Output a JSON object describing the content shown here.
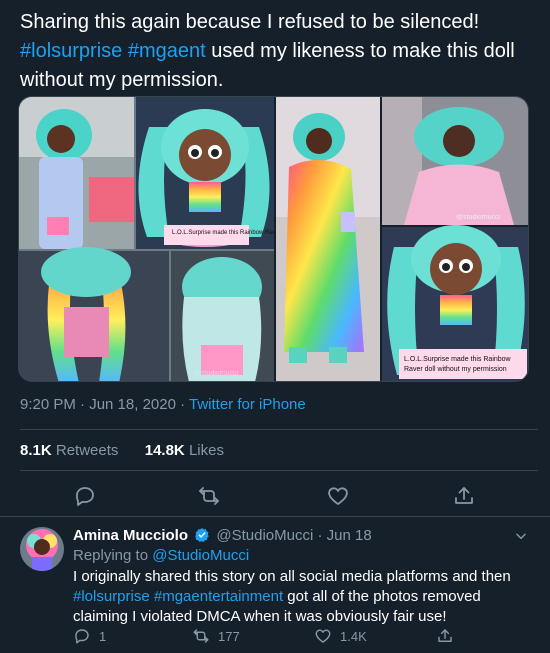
{
  "tweet": {
    "text_line1": "Sharing this again because I refused to be silenced!",
    "hashtag1": "#lolsurprise",
    "hashtag2": "#mgaent",
    "text_rest": "used my likeness to make this doll without my permission.",
    "time": "9:20 PM · Jun 18, 2020",
    "separator": " · ",
    "source": "Twitter for iPhone",
    "retweets_count": "8.1K",
    "retweets_label": "Retweets",
    "likes_count": "14.8K",
    "likes_label": "Likes",
    "media": {
      "caption_left": "L.O.L.Surprise made this Rainbow Raver doll without my permission",
      "caption_right_1": "L.O.L.Surprise made this Rainbow",
      "caption_right_2": "Raver doll without my permission",
      "watermark_left": "@studiomucci",
      "watermark_right": "@studiomucci"
    },
    "actions": {
      "reply_icon": "reply-icon",
      "retweet_icon": "retweet-icon",
      "like_icon": "heart-icon",
      "share_icon": "share-icon"
    }
  },
  "reply": {
    "name": "Amina Mucciolo",
    "handle": "@StudioMucci",
    "date": "· Jun 18",
    "replying_prefix": "Replying to",
    "replying_to": "@StudioMucci",
    "body_part1": "I originally shared this story on all social media platforms and then",
    "hashtag1": "#lolsurprise",
    "hashtag2": "#mgaentertainment",
    "body_part2": "got all of the photos removed claiming I violated DMCA when it was obviously fair use!",
    "reply_count": "1",
    "retweet_count": "177",
    "like_count": "1.4K"
  },
  "colors": {
    "background": "#15202b",
    "accent": "#1da1f2",
    "muted": "#8899a6",
    "divider": "#38444d"
  }
}
